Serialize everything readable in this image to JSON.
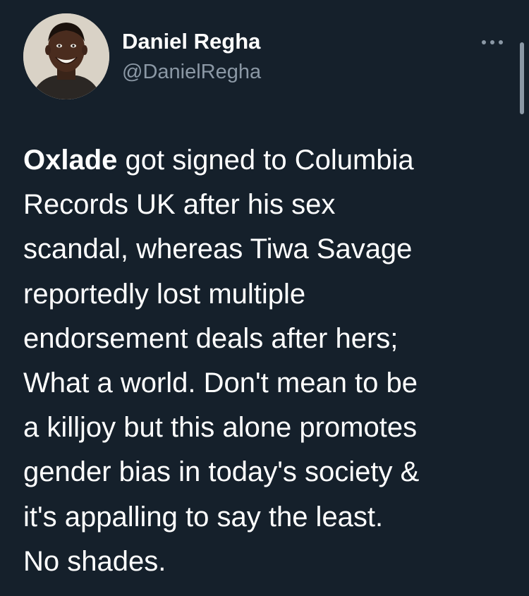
{
  "author": {
    "name": "Daniel Regha",
    "handle": "@DanielRegha",
    "avatar_icon": "profile-photo"
  },
  "menu": {
    "icon": "more-horizontal-icon"
  },
  "tweet": {
    "highlight": "Oxlade",
    "lines": [
      " got signed to Columbia",
      "Records UK after his sex",
      "scandal, whereas Tiwa Savage",
      "reportedly lost multiple",
      "endorsement deals after hers;",
      "What a world. Don't mean to be",
      "a killjoy but this alone promotes",
      "gender bias in today's society &",
      "it's appalling to say the least.",
      "No shades."
    ]
  },
  "theme": {
    "background": "#15202b",
    "text": "#ffffff",
    "secondary_text": "#8b98a5"
  }
}
